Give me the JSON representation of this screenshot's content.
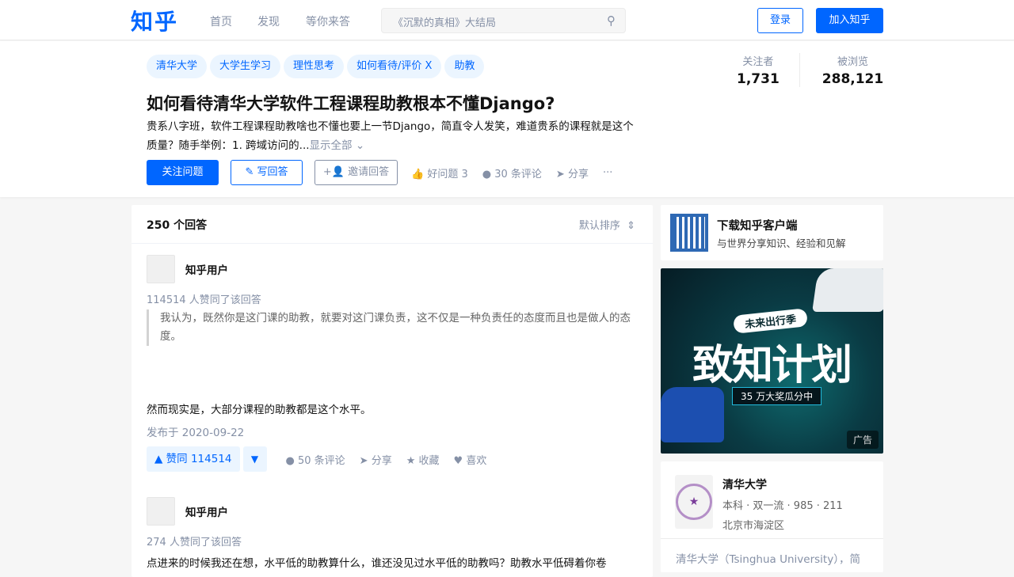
{
  "header": {
    "logo": "知乎",
    "nav": [
      "首页",
      "发现",
      "等你来答"
    ],
    "search_placeholder": "《沉默的真相》大结局",
    "login": "登录",
    "join": "加入知乎"
  },
  "question": {
    "tags": [
      "清华大学",
      "大学生学习",
      "理性思考",
      "如何看待/评价 X",
      "助教"
    ],
    "title": "如何看待清华大学软件工程课程助教根本不懂Django?",
    "desc": "贵系八字班，软件工程课程助教啥也不懂也要上一节Django，简直令人发笑，难道贵系的课程就是这个质量？随手举例：1. 跨域访问的...",
    "show_all": "显示全部",
    "follow": "关注问题",
    "write": "写回答",
    "invite": "邀请回答",
    "good": "好问题 3",
    "comments": "30 条评论",
    "share": "分享",
    "more": "···",
    "followers_label": "关注者",
    "followers": "1,731",
    "views_label": "被浏览",
    "views": "288,121"
  },
  "answers": {
    "count": "250 个回答",
    "sort": "默认排序",
    "items": [
      {
        "user": "知乎用户",
        "votes": "114514 人赞同了该回答",
        "quote": "我认为，既然你是这门课的助教，就要对这门课负责，这不仅是一种负责任的态度而且也是做人的态度。",
        "text": "然而现实是，大部分课程的助教都是这个水平。",
        "date": "发布于 2020-09-22",
        "upvote": "▲ 赞同 114514",
        "comments": "50 条评论",
        "share": "分享",
        "collect": "收藏",
        "like": "喜欢"
      },
      {
        "user": "知乎用户",
        "votes": "274 人赞同了该回答",
        "text": "点进来的时候我还在想，水平低的助教算什么，谁还没见过水平低的助教吗？助教水平低碍着你卷"
      }
    ]
  },
  "sidebar": {
    "app_title": "下载知乎客户端",
    "app_sub": "与世界分享知识、经验和见解",
    "ad": {
      "season": "未来出行季",
      "title": "致知计划",
      "prize": "35 万大奖瓜分中",
      "label": "广告"
    },
    "school": {
      "name": "清华大学",
      "meta": "本科 · 双一流 · 985 · 211",
      "location": "北京市海淀区",
      "intro": "清华大学（Tsinghua University），简"
    }
  }
}
